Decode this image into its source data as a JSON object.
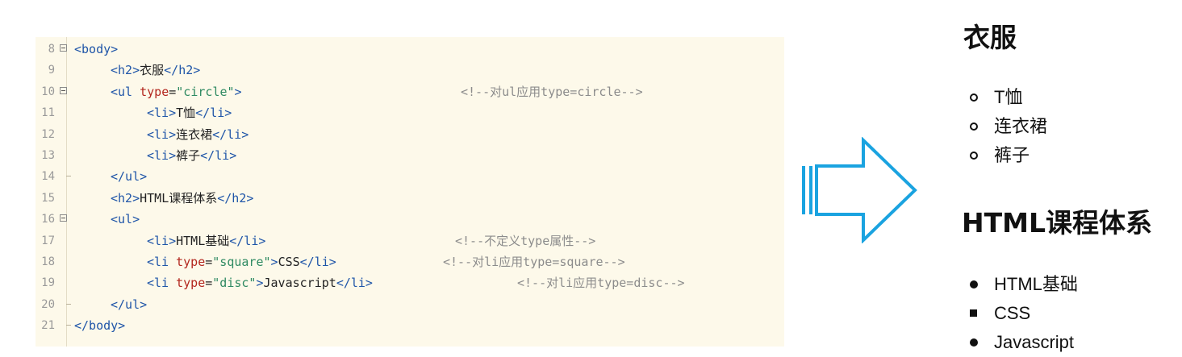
{
  "editor": {
    "lines": [
      {
        "n": "8",
        "fold": "open",
        "parts": [
          [
            "t",
            "<body>"
          ]
        ]
      },
      {
        "n": "9",
        "fold": "",
        "indent": 2,
        "parts": [
          [
            "t",
            "<h2>"
          ],
          [
            "p",
            "衣服"
          ],
          [
            "t",
            "</h2>"
          ]
        ]
      },
      {
        "n": "10",
        "fold": "open",
        "indent": 2,
        "parts": [
          [
            "t",
            "<ul "
          ],
          [
            "a",
            "type"
          ],
          [
            "p",
            "="
          ],
          [
            "s",
            "\"circle\""
          ],
          [
            "t",
            ">"
          ]
        ],
        "comment": "<!--对ul应用type=circle-->",
        "cpos": 527
      },
      {
        "n": "11",
        "fold": "",
        "indent": 4,
        "parts": [
          [
            "t",
            "<li>"
          ],
          [
            "p",
            "T恤"
          ],
          [
            "t",
            "</li>"
          ]
        ]
      },
      {
        "n": "12",
        "fold": "",
        "indent": 4,
        "parts": [
          [
            "t",
            "<li>"
          ],
          [
            "p",
            "连衣裙"
          ],
          [
            "t",
            "</li>"
          ]
        ]
      },
      {
        "n": "13",
        "fold": "",
        "indent": 4,
        "parts": [
          [
            "t",
            "<li>"
          ],
          [
            "p",
            "裤子"
          ],
          [
            "t",
            "</li>"
          ]
        ]
      },
      {
        "n": "14",
        "fold": "end",
        "indent": 2,
        "parts": [
          [
            "t",
            "</ul>"
          ]
        ]
      },
      {
        "n": "15",
        "fold": "",
        "indent": 2,
        "parts": [
          [
            "t",
            "<h2>"
          ],
          [
            "p",
            "HTML课程体系"
          ],
          [
            "t",
            "</h2>"
          ]
        ]
      },
      {
        "n": "16",
        "fold": "open",
        "indent": 2,
        "parts": [
          [
            "t",
            "<ul>"
          ]
        ]
      },
      {
        "n": "17",
        "fold": "",
        "indent": 4,
        "parts": [
          [
            "t",
            "<li>"
          ],
          [
            "p",
            "HTML基础"
          ],
          [
            "t",
            "</li>"
          ]
        ],
        "comment": "<!--不定义type属性-->",
        "cpos": 520
      },
      {
        "n": "18",
        "fold": "",
        "indent": 4,
        "parts": [
          [
            "t",
            "<li "
          ],
          [
            "a",
            "type"
          ],
          [
            "p",
            "="
          ],
          [
            "s",
            "\"square\""
          ],
          [
            "t",
            ">"
          ],
          [
            "p",
            "CSS"
          ],
          [
            "t",
            "</li>"
          ]
        ],
        "comment": "<!--对li应用type=square-->",
        "cpos": 505
      },
      {
        "n": "19",
        "fold": "",
        "indent": 4,
        "parts": [
          [
            "t",
            "<li "
          ],
          [
            "a",
            "type"
          ],
          [
            "p",
            "="
          ],
          [
            "s",
            "\"disc\""
          ],
          [
            "t",
            ">"
          ],
          [
            "p",
            "Javascript"
          ],
          [
            "t",
            "</li>"
          ]
        ],
        "comment": "<!--对li应用type=disc-->",
        "cpos": 597
      },
      {
        "n": "20",
        "fold": "end",
        "indent": 2,
        "parts": [
          [
            "t",
            "</ul>"
          ]
        ]
      },
      {
        "n": "21",
        "fold": "end",
        "parts": [
          [
            "t",
            "</body>"
          ]
        ]
      }
    ]
  },
  "output": {
    "heading1": "衣服",
    "list1": [
      "T恤",
      "连衣裙",
      "裤子"
    ],
    "list1_marker": "circle",
    "heading2": "HTML课程体系",
    "list2": [
      {
        "text": "HTML基础",
        "marker": "disc"
      },
      {
        "text": "CSS",
        "marker": "square"
      },
      {
        "text": "Javascript",
        "marker": "disc"
      }
    ]
  },
  "colors": {
    "editor_bg": "#fdf9ea",
    "tag": "#1f55a8",
    "attribute": "#b3261e",
    "string": "#2f8a62",
    "comment": "#8c8c8c",
    "arrow": "#1aa3e0"
  }
}
